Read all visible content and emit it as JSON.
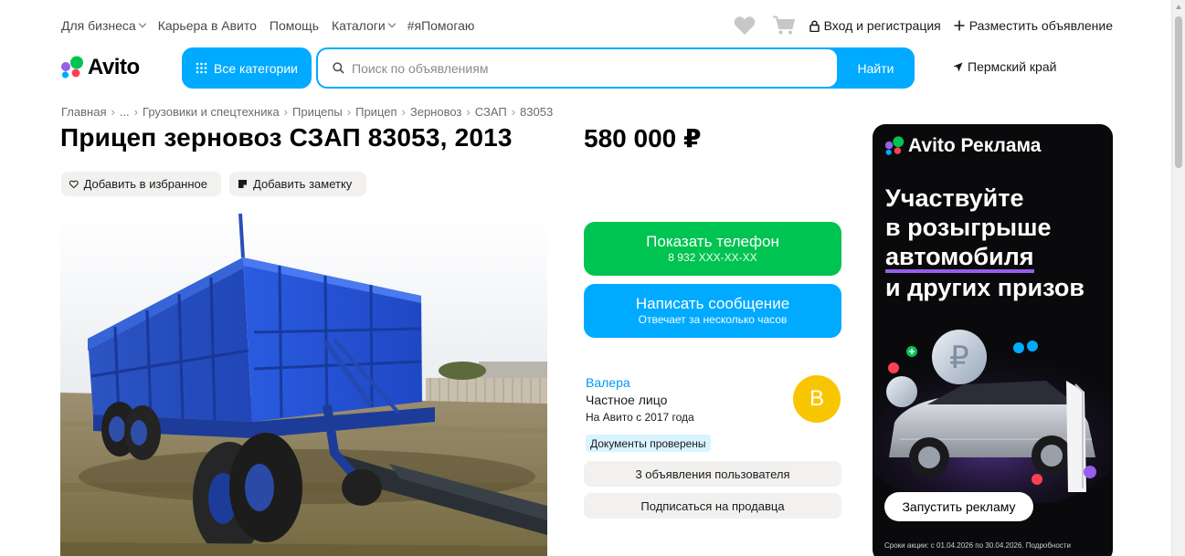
{
  "header": {
    "links": [
      {
        "label": "Для бизнеса",
        "chevron": true
      },
      {
        "label": "Карьера в Авито",
        "chevron": false
      },
      {
        "label": "Помощь",
        "chevron": false
      },
      {
        "label": "Каталоги",
        "chevron": true
      },
      {
        "label": "#яПомогаю",
        "chevron": false
      }
    ],
    "login_label": "Вход и регистрация",
    "post_ad_label": "Разместить объявление",
    "icons": [
      "heart-icon",
      "cart-icon",
      "lock-icon",
      "plus-icon"
    ]
  },
  "logo": {
    "text": "Avito",
    "dot_colors": [
      "#00c451",
      "#965eeb",
      "#ff4053",
      "#00aaff"
    ]
  },
  "search": {
    "categories_label": "Все категории",
    "placeholder": "Поиск по объявлениям",
    "value": "",
    "find_label": "Найти",
    "region": "Пермский край",
    "accent": "#00aaff"
  },
  "breadcrumbs": [
    "Главная",
    "...",
    "Грузовики и спецтехника",
    "Прицепы",
    "Прицеп",
    "Зерновоз",
    "СЗАП",
    "83053"
  ],
  "listing": {
    "title": "Прицеп зерновоз СЗАП 83053, 2013",
    "price": "580 000 ₽",
    "favorite_label": "Добавить в избранное",
    "note_label": "Добавить заметку",
    "photo_alt": "Синий прицеп зерновоз СЗАП"
  },
  "contact": {
    "phone_label": "Показать телефон",
    "phone_masked": "8 932 XXX-XX-XX",
    "phone_color": "#00c451",
    "message_label": "Написать сообщение",
    "message_sub": "Отвечает за несколько часов",
    "message_color": "#00aaff"
  },
  "seller": {
    "name": "Валера",
    "type": "Частное лицо",
    "since": "На Авито с 2017 года",
    "avatar_letter": "В",
    "avatar_color": "#f8c600",
    "verified_label": "Документы проверены",
    "ads_button_label": "3 объявления пользователя",
    "subscribe_label": "Подписаться на продавца"
  },
  "ad_banner": {
    "brand": "Avito Реклама",
    "headline_lines": [
      "Участвуйте",
      "в розыгрыше",
      "автомобиля",
      "и других призов"
    ],
    "cta_label": "Запустить рекламу",
    "fine_print": "Сроки акции: с 01.04.2026 по 30.04.2026. Подробности"
  }
}
